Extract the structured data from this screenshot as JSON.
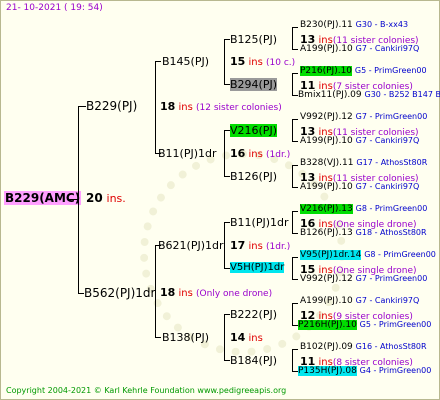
{
  "date": "21- 10-2021 ( 19: 54)",
  "footer": "Copyright 2004-2021 © Karl Kehrle Foundation    www.pedigreeapis.org",
  "root": {
    "name": "B229(AMC)",
    "ins_num": "20",
    "ins_word": "ins."
  },
  "g1": [
    {
      "name": "B229(PJ)",
      "ins_num": "18",
      "ins_word": "ins",
      "note": "(12 sister colonies)"
    },
    {
      "name": "B562(PJ)1dr",
      "ins_num": "18",
      "ins_word": "ins",
      "note": "(Only one drone)"
    }
  ],
  "g2": [
    {
      "name": "B145(PJ)",
      "ins_num": "15",
      "ins_word": "ins",
      "note": "(10 c.)"
    },
    {
      "name": "B11(PJ)1dr",
      "ins_num": "16",
      "ins_word": "ins",
      "note": "(1dr.)"
    },
    {
      "name": "B621(PJ)1dr",
      "ins_num": "17",
      "ins_word": "ins",
      "note": "(1dr.)"
    },
    {
      "name": "B138(PJ)",
      "ins_num": "14",
      "ins_word": "ins",
      "note": ""
    }
  ],
  "g3": [
    {
      "name": "B125(PJ)",
      "ins_num": "13",
      "ins_word": "ins",
      "note": "(11 sister colonies)"
    },
    {
      "name": "B294(PJ)",
      "ins_num": "11",
      "ins_word": "ins",
      "note": "(7 sister colonies)"
    },
    {
      "name": "V216(PJ)",
      "ins_num": "13",
      "ins_word": "ins",
      "note": "(11 sister colonies)"
    },
    {
      "name": "B126(PJ)",
      "ins_num": "13",
      "ins_word": "ins",
      "note": "(11 sister colonies)"
    },
    {
      "name": "B11(PJ)1dr",
      "ins_num": "16",
      "ins_word": "ins",
      "note": "(One single drone)"
    },
    {
      "name": "V5H(PJ)1dr",
      "ins_num": "15",
      "ins_word": "ins",
      "note": "(One single drone)"
    },
    {
      "name": "B222(PJ)",
      "ins_num": "12",
      "ins_word": "ins",
      "note": "(9 sister colonies)"
    },
    {
      "name": "B184(PJ)",
      "ins_num": "11",
      "ins_word": "ins",
      "note": "(8 sister colonies)"
    }
  ],
  "g4": [
    {
      "name": "B230(PJ).11",
      "code": "G30 - B-xx43"
    },
    {
      "name": "A199(PJ).10",
      "code": "G7 - Cankiri97Q"
    },
    {
      "name": "P216(PJ).10",
      "code": "G5 - PrimGreen00"
    },
    {
      "name": "Bmix11(PJ).09",
      "code": "G30 - B252 B147 B"
    },
    {
      "name": "V992(PJ).12",
      "code": "G7 - PrimGreen00"
    },
    {
      "name": "A199(PJ).10",
      "code": "G7 - Cankiri97Q"
    },
    {
      "name": "B328(VJ).11",
      "code": "G17 - AthosSt80R"
    },
    {
      "name": "A199(PJ).10",
      "code": "G7 - Cankiri97Q"
    },
    {
      "name": "V216(PJ).13",
      "code": "G8 - PrimGreen00"
    },
    {
      "name": "B126(PJ).13",
      "code": "G18 - AthosSt80R"
    },
    {
      "name": "V95(PJ)1dr.14",
      "code": "G8 - PrimGreen00"
    },
    {
      "name": "V992(PJ).12",
      "code": "G7 - PrimGreen00"
    },
    {
      "name": "A199(PJ).10",
      "code": "G7 - Cankiri97Q"
    },
    {
      "name": "P216H(PJ).10",
      "code": "G5 - PrimGreen00"
    },
    {
      "name": "B102(PJ).09",
      "code": "G16 - AthosSt80R"
    },
    {
      "name": "P135H(PJ).08",
      "code": "G4 - PrimGreen00"
    }
  ]
}
